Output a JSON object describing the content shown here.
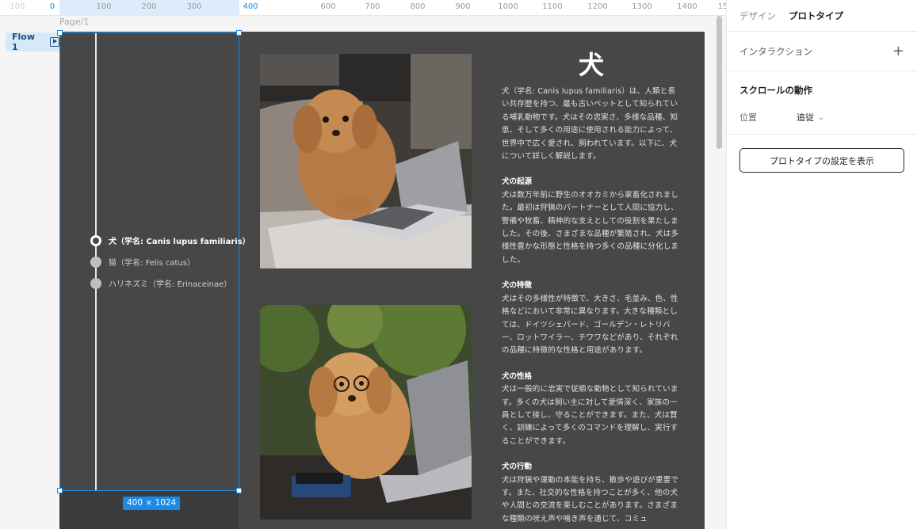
{
  "ruler": {
    "ticks": [
      "-100",
      "0",
      "100",
      "200",
      "300",
      "400",
      "600",
      "700",
      "800",
      "900",
      "1000",
      "1100",
      "1200",
      "1300",
      "1400",
      "15"
    ]
  },
  "canvas": {
    "page_label": "Page/1",
    "flow_label": "Flow 1",
    "size_badge": "400 × 1024"
  },
  "timeline": {
    "items": [
      {
        "label": "犬（学名: Canis lupus familiaris）",
        "active": true
      },
      {
        "label": "猫（学名: Felis catus）",
        "active": false
      },
      {
        "label": "ハリネズミ（学名: Erinaceinae）",
        "active": false
      }
    ]
  },
  "article": {
    "title": "犬",
    "intro": "犬（学名: Canis lupus familiaris）は、人類と長い共存歴を持つ、最も古いペットとして知られている哺乳動物です。犬はその忠実さ、多様な品種、知恵、そして多くの用途に使用される能力によって、世界中で広く愛され、飼われています。以下に、犬について詳しく解説します。",
    "sections": [
      {
        "title": "犬の起源",
        "body": "犬は数万年前に野生のオオカミから家畜化されました。最初は狩猟のパートナーとして人間に協力し、警備や牧畜、精神的な支えとしての役割を果たしました。その後、さまざまな品種が繁殖され、犬は多様性豊かな形態と性格を持つ多くの品種に分化しました。"
      },
      {
        "title": "犬の特徴",
        "body": "犬はその多様性が特徴で、大きさ、毛並み、色、性格などにおいて非常に異なります。大きな種類としては、ドイツシェパード、ゴールデン・レトリバー、ロットワイラー、チワワなどがあり、それぞれの品種に特徴的な性格と用途があります。"
      },
      {
        "title": "犬の性格",
        "body": "犬は一般的に忠実で従順な動物として知られています。多くの犬は飼い主に対して愛情深く、家族の一員として接し、守ることができます。また、犬は賢く、訓練によって多くのコマンドを理解し、実行することができます。"
      },
      {
        "title": "犬の行動",
        "body": "犬は狩猟や運動の本能を持ち、散歩や遊びが重要です。また、社交的な性格を持つことが多く、他の犬や人間との交流を楽しむことがあります。さまざまな種類の吠え声や鳴き声を通じて、コミュ"
      }
    ]
  },
  "panel": {
    "tabs": [
      "デザイン",
      "プロトタイプ"
    ],
    "active_tab": 1,
    "interaction_title": "インタラクション",
    "scroll_title": "スクロールの動作",
    "position_label": "位置",
    "position_value": "追従",
    "proto_button": "プロトタイプの設定を表示"
  },
  "colors": {
    "accent": "#1a8ae6",
    "frame_bg": "#474747",
    "panel_bg": "#ffffff"
  }
}
